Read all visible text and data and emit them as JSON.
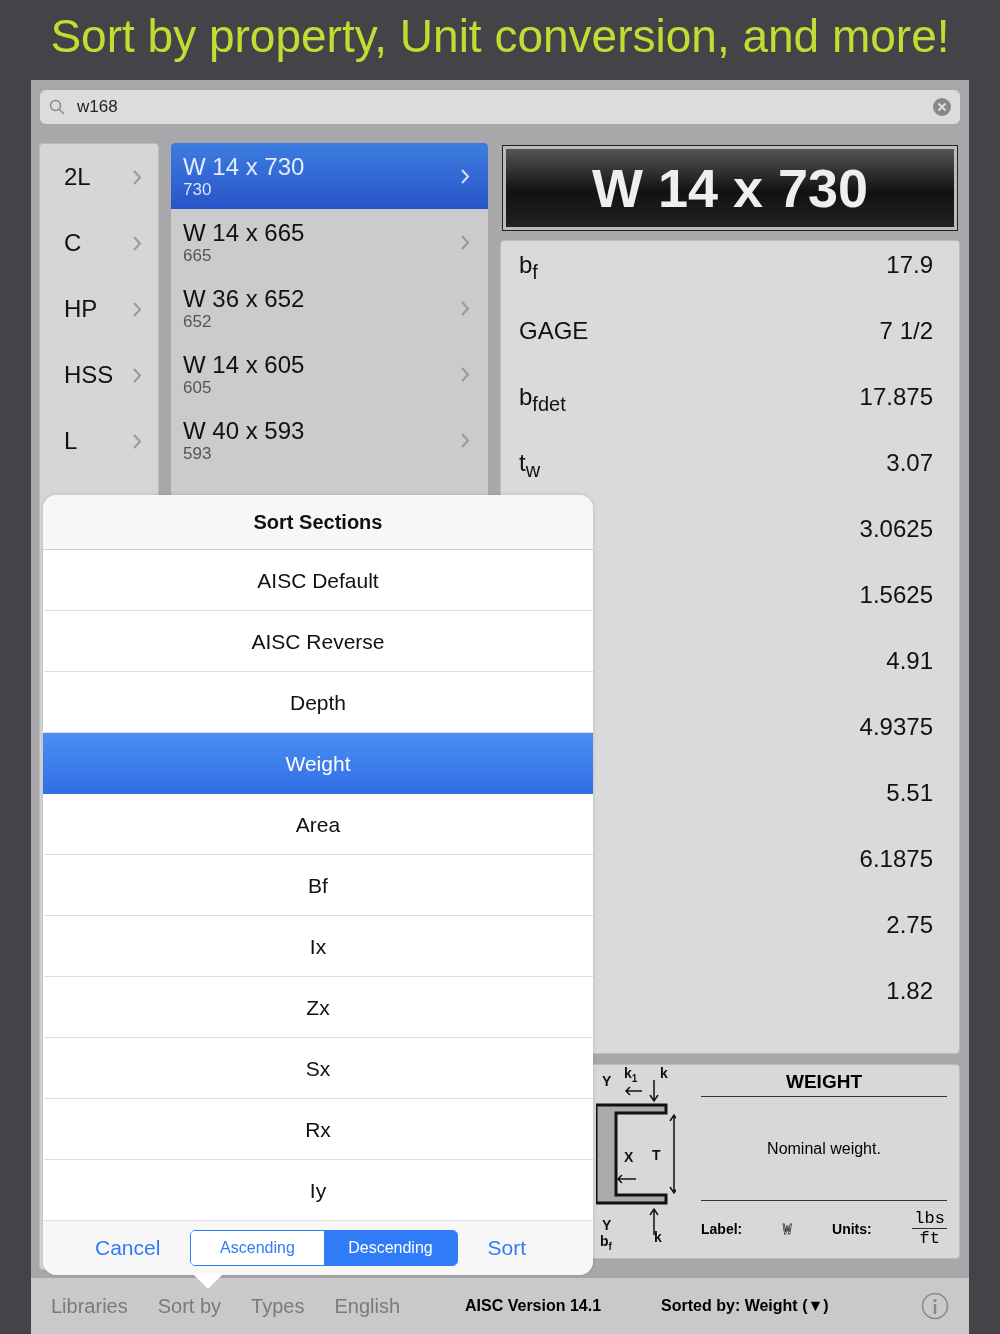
{
  "headline": "Sort by property, Unit conversion, and more!",
  "search": {
    "value": "w168"
  },
  "categories": [
    {
      "label": "2L"
    },
    {
      "label": "C"
    },
    {
      "label": "HP"
    },
    {
      "label": "HSS"
    },
    {
      "label": "L"
    }
  ],
  "sections": [
    {
      "name": "W 14 x 730",
      "weight": "730",
      "selected": true
    },
    {
      "name": "W 14 x 665",
      "weight": "665",
      "selected": false
    },
    {
      "name": "W 36 x 652",
      "weight": "652",
      "selected": false
    },
    {
      "name": "W 14 x 605",
      "weight": "605",
      "selected": false
    },
    {
      "name": "W 40 x 593",
      "weight": "593",
      "selected": false
    }
  ],
  "detail": {
    "title": "W 14 x 730",
    "properties": [
      {
        "label": "b$_{f}$",
        "value": "17.9"
      },
      {
        "label": "GAGE",
        "value": "7 1/2"
      },
      {
        "label": "b$_{f}$$_{det}$",
        "value": "17.875"
      },
      {
        "label": "t$_{w}$",
        "value": "3.07"
      },
      {
        "value": "3.0625"
      },
      {
        "value": "1.5625"
      },
      {
        "value": "4.91"
      },
      {
        "value": "4.9375"
      },
      {
        "value": "5.51"
      },
      {
        "value": "6.1875"
      },
      {
        "value": "2.75"
      },
      {
        "value": "1.82"
      }
    ]
  },
  "diagram": {
    "labels": [
      "Y",
      "k$_{1}$",
      "k",
      "X",
      "T",
      "Y",
      "b$_{f}$",
      "k"
    ]
  },
  "property_info": {
    "title": "WEIGHT",
    "description": "Nominal weight.",
    "label_caption": "Label:",
    "label_symbol": "W",
    "units_caption": "Units:",
    "units_numerator": "lbs",
    "units_denominator": "ft"
  },
  "sort_popover": {
    "title": "Sort Sections",
    "options": [
      {
        "label": "AISC Default",
        "selected": false
      },
      {
        "label": "AISC Reverse",
        "selected": false
      },
      {
        "label": "Depth",
        "selected": false
      },
      {
        "label": "Weight",
        "selected": true
      },
      {
        "label": "Area",
        "selected": false
      },
      {
        "label": "Bf",
        "selected": false
      },
      {
        "label": "Ix",
        "selected": false
      },
      {
        "label": "Zx",
        "selected": false
      },
      {
        "label": "Sx",
        "selected": false
      },
      {
        "label": "Rx",
        "selected": false
      },
      {
        "label": "Iy",
        "selected": false
      }
    ],
    "cancel": "Cancel",
    "directions": [
      {
        "label": "Ascending",
        "selected": false
      },
      {
        "label": "Descending",
        "selected": true
      }
    ],
    "sort": "Sort"
  },
  "toolbar": {
    "buttons": [
      "Libraries",
      "Sort by",
      "Types",
      "English"
    ],
    "version": "AISC Version 14.1",
    "sorted_by": "Sorted by: Weight (▼)"
  }
}
